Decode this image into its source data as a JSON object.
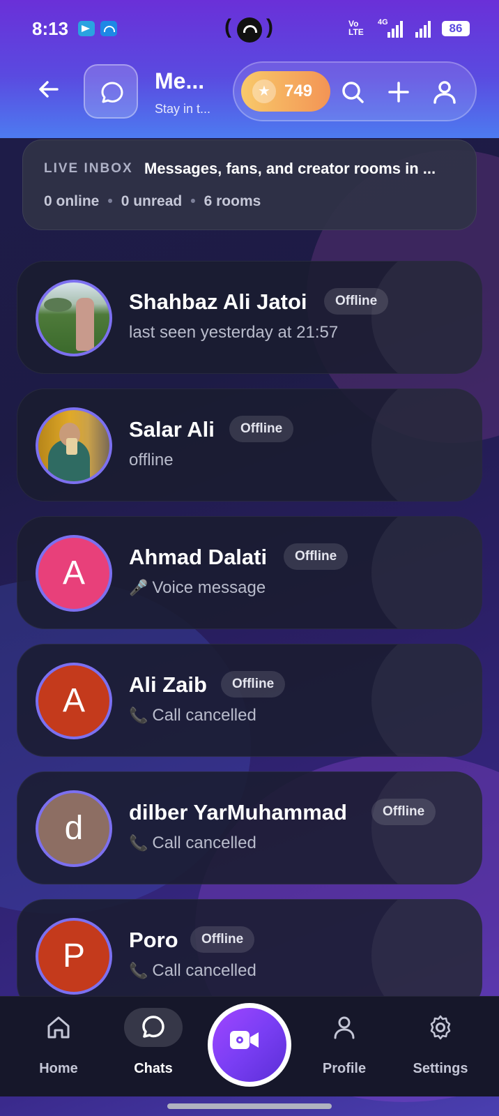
{
  "status_bar": {
    "time": "8:13",
    "network_label": "Vo LTE",
    "network_type": "4G",
    "battery": "86"
  },
  "header": {
    "title": "Me...",
    "subtitle": "Stay in t...",
    "coins": "749"
  },
  "live_inbox": {
    "tag": "LIVE INBOX",
    "text": "Messages, fans, and creator rooms in ...",
    "online": "0 online",
    "unread": "0 unread",
    "rooms": "6 rooms"
  },
  "chats": [
    {
      "name": "Shahbaz Ali Jatoi",
      "status": "Offline",
      "preview": "last seen yesterday at 21:57",
      "preview_icon": "",
      "avatar_type": "photo"
    },
    {
      "name": "Salar Ali",
      "status": "Offline",
      "preview": "offline",
      "preview_icon": "",
      "avatar_type": "photo"
    },
    {
      "name": "Ahmad Dalati",
      "status": "Offline",
      "preview": "Voice message",
      "preview_icon": "🎤",
      "avatar_letter": "A",
      "avatar_color": "#e8407a"
    },
    {
      "name": "Ali Zaib",
      "status": "Offline",
      "preview": "Call cancelled",
      "preview_icon": "📞",
      "avatar_letter": "A",
      "avatar_color": "#c43a1c"
    },
    {
      "name": "dilber YarMuhammad",
      "status": "Offline",
      "preview": "Call cancelled",
      "preview_icon": "📞",
      "avatar_letter": "d",
      "avatar_color": "#8d6e63"
    },
    {
      "name": "Poro",
      "status": "Offline",
      "preview": "Call cancelled",
      "preview_icon": "📞",
      "avatar_letter": "P",
      "avatar_color": "#c43a1c"
    }
  ],
  "nav": {
    "home": "Home",
    "chats": "Chats",
    "profile": "Profile",
    "settings": "Settings"
  },
  "colors": {
    "accent": "#7a3ef4",
    "avatar_ring": "#7c70f0",
    "coin_gradient_start": "#f8c96a",
    "coin_gradient_end": "#f39455"
  }
}
